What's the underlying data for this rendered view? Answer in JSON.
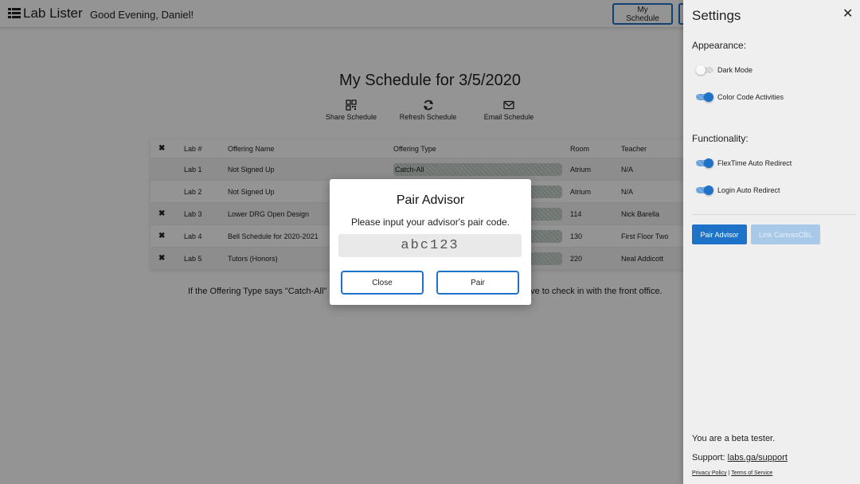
{
  "header": {
    "brand": "Lab Lister",
    "greeting": "Good Evening, Daniel!",
    "my_schedule_label": "My Schedule"
  },
  "main": {
    "title": "My Schedule for 3/5/2020",
    "actions": {
      "share": "Share Schedule",
      "refresh": "Refresh Schedule",
      "email": "Email Schedule"
    },
    "table": {
      "headers": {
        "remove": "✖",
        "lab": "Lab #",
        "name": "Offering Name",
        "type": "Offering Type",
        "room": "Room",
        "teacher": "Teacher"
      },
      "rows": [
        {
          "remove": "",
          "lab": "Lab 1",
          "name": "Not Signed Up",
          "type": "Catch-All",
          "room": "Atrium",
          "teacher": "N/A"
        },
        {
          "remove": "",
          "lab": "Lab 2",
          "name": "Not Signed Up",
          "type": "",
          "room": "Atrium",
          "teacher": "N/A"
        },
        {
          "remove": "✖",
          "lab": "Lab 3",
          "name": "Lower DRG Open Design",
          "type": "",
          "room": "114",
          "teacher": "Nick Barella"
        },
        {
          "remove": "✖",
          "lab": "Lab 4",
          "name": "Bell Schedule for 2020-2021",
          "type": "",
          "room": "130",
          "teacher": "First Floor Two"
        },
        {
          "remove": "✖",
          "lab": "Lab 5",
          "name": "Tutors (Honors)",
          "type": "",
          "room": "220",
          "teacher": "Neal Addicott"
        }
      ]
    },
    "note_left": "If the Offering Type says \"Catch-All\"",
    "note_right": "ave to check in with the front office."
  },
  "modal": {
    "title": "Pair Advisor",
    "subtitle": "Please input your advisor's pair code.",
    "input_value": "abc123",
    "close_label": "Close",
    "pair_label": "Pair"
  },
  "settings": {
    "title": "Settings",
    "close_glyph": "✕",
    "appearance_label": "Appearance:",
    "functionality_label": "Functionality:",
    "toggles": {
      "dark_mode": {
        "label": "Dark Mode",
        "on": false
      },
      "color_code": {
        "label": "Color Code Activities",
        "on": true
      },
      "flextime": {
        "label": "FlexTime Auto Redirect",
        "on": true
      },
      "login": {
        "label": "Login Auto Redirect",
        "on": true
      }
    },
    "pair_advisor_label": "Pair Advisor",
    "link_canvas_label": "Link CanvasCBL",
    "beta_text": "You are a beta tester.",
    "support_prefix": "Support:",
    "support_link": "labs.ga/support",
    "privacy_label": "Privacy Policy",
    "separator": "|",
    "terms_label": "Terms of Service"
  },
  "colors": {
    "accent": "#1e73c8",
    "drawer_bg": "#efefef",
    "overlay": "rgba(0,0,0,0.42)"
  }
}
